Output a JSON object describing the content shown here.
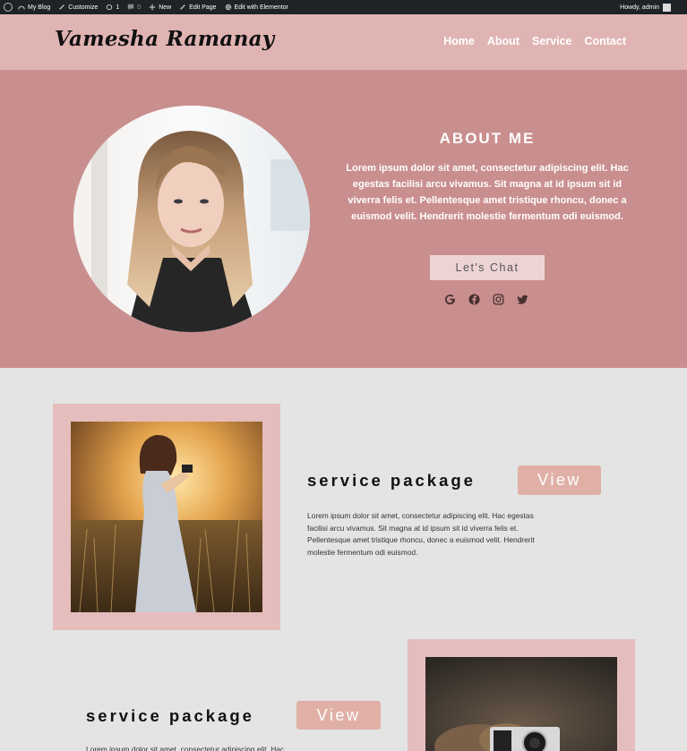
{
  "adminbar": {
    "my_blog": "My Blog",
    "customize": "Customize",
    "updates_count": "1",
    "comments_count": "0",
    "new_label": "New",
    "edit_page": "Edit Page",
    "edit_elementor": "Edit with Elementor",
    "howdy": "Howdy, admin"
  },
  "header": {
    "logo": "Vamesha Ramanay",
    "nav": [
      "Home",
      "About",
      "Service",
      "Contact"
    ]
  },
  "hero": {
    "title": "ABOUT ME",
    "text": "Lorem ipsum dolor sit amet, consectetur adipiscing elit. Hac egestas facilisi arcu vivamus. Sit magna at id ipsum sit id viverra felis et. Pellentesque amet tristique rhoncu, donec a euismod velit. Hendrerit molestie fermentum odi euismod.",
    "button": "Let's Chat",
    "socials": [
      "google-icon",
      "facebook-icon",
      "instagram-icon",
      "twitter-icon"
    ]
  },
  "services": [
    {
      "title": "service package",
      "button": "View",
      "text": "Lorem ipsum dolor sit amet, consectetur adipiscing elit. Hac egestas facilisi arcu vivamus. Sit magna at id ipsum sit id viverra felis et. Pellentesque amet tristique rhoncu, donec a euismod velit. Hendrerit molestie fermentum odi euismod."
    },
    {
      "title": "service package",
      "button": "View",
      "text": "Lorem ipsum dolor sit amet, consectetur adipiscing elit. Hac"
    }
  ],
  "colors": {
    "header_bg": "#e0b4b3",
    "hero_bg": "#c98f8e",
    "frame": "#e5bdbd",
    "view_button": "#e0b0a6",
    "page_bg": "#e4e4e4"
  }
}
